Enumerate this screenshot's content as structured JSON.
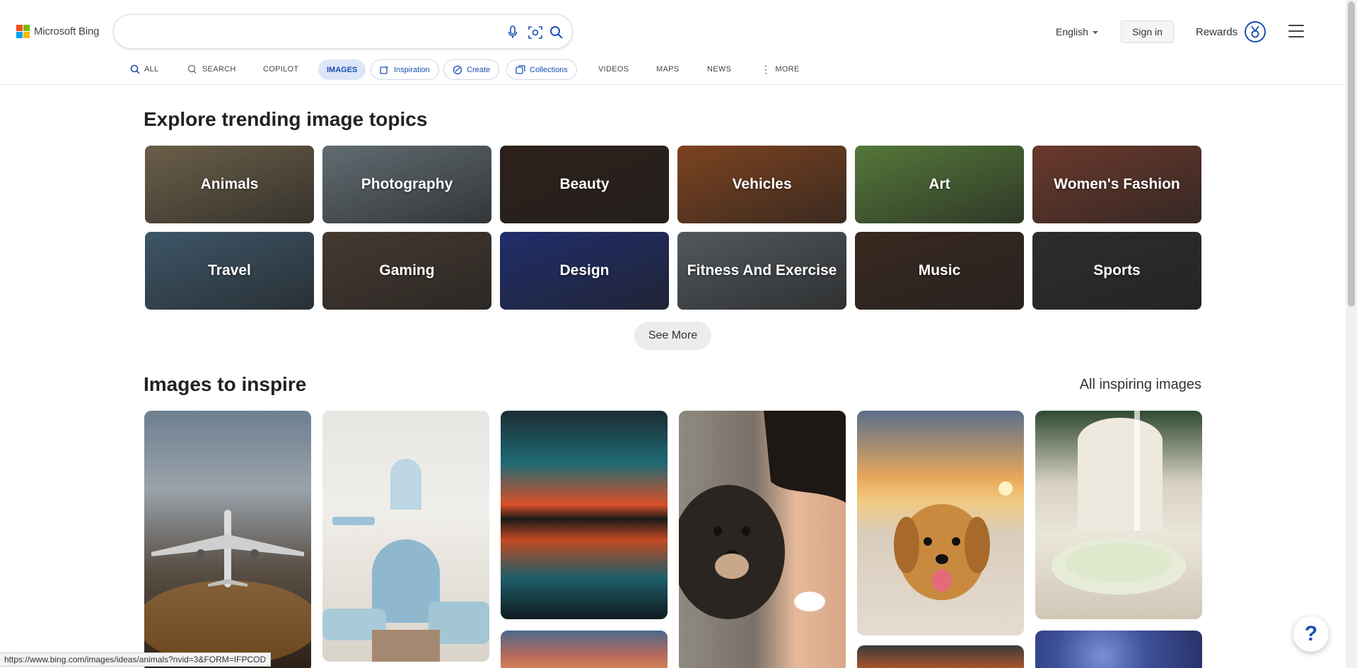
{
  "header": {
    "logo_text": "Microsoft Bing",
    "search_value": "",
    "language": "English",
    "signin_label": "Sign in",
    "rewards_label": "Rewards"
  },
  "nav": {
    "all": "ALL",
    "search": "SEARCH",
    "copilot": "COPILOT",
    "images": "IMAGES",
    "inspiration": "Inspiration",
    "create": "Create",
    "collections": "Collections",
    "videos": "VIDEOS",
    "maps": "MAPS",
    "news": "NEWS",
    "more": "MORE"
  },
  "trending": {
    "title": "Explore trending image topics",
    "topics": [
      {
        "label": "Animals",
        "bg": "#8a7a5e"
      },
      {
        "label": "Photography",
        "bg": "#7d8b93"
      },
      {
        "label": "Beauty",
        "bg": "#3b2a22"
      },
      {
        "label": "Vehicles",
        "bg": "#a0562a"
      },
      {
        "label": "Art",
        "bg": "#6c9a4a"
      },
      {
        "label": "Women's Fashion",
        "bg": "#8a4a3a"
      },
      {
        "label": "Travel",
        "bg": "#4f6f86"
      },
      {
        "label": "Gaming",
        "bg": "#5a4a3e"
      },
      {
        "label": "Design",
        "bg": "#2a3b8a"
      },
      {
        "label": "Fitness And Exercise",
        "bg": "#6b7278"
      },
      {
        "label": "Music",
        "bg": "#4a3428"
      },
      {
        "label": "Sports",
        "bg": "#3b3b3b"
      }
    ],
    "see_more": "See More"
  },
  "inspire": {
    "title": "Images to inspire",
    "all_link": "All inspiring images"
  },
  "status_url": "https://www.bing.com/images/ideas/animals?nvid=3&FORM=IFPCOD",
  "help_label": "?",
  "colors": {
    "accent": "#1a4fb5",
    "active_tab_bg": "#dce6f7"
  }
}
